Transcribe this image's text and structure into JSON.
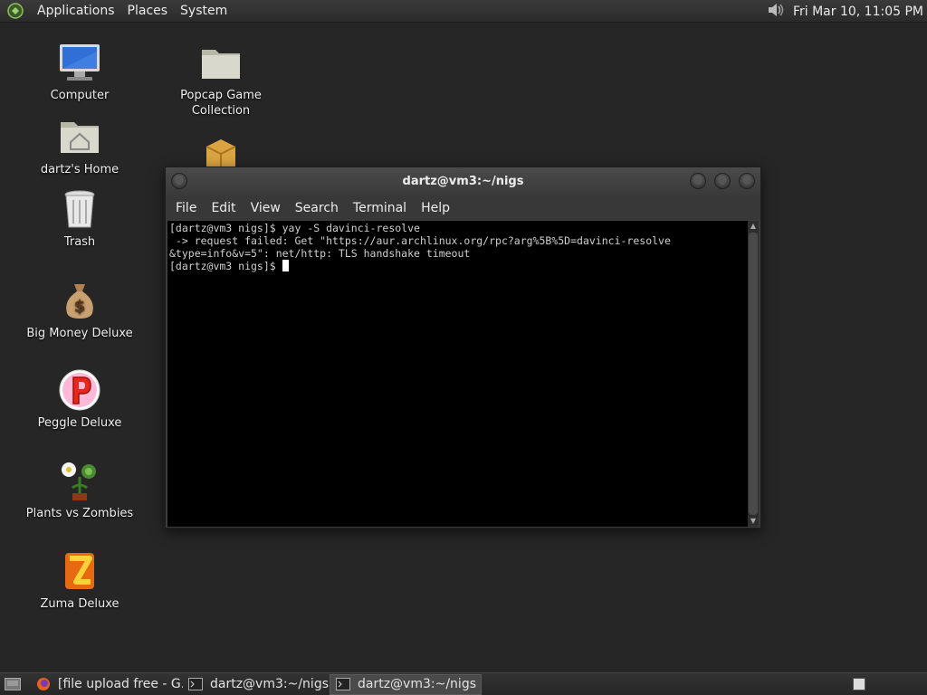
{
  "top_panel": {
    "menus": [
      "Applications",
      "Places",
      "System"
    ],
    "clock": "Fri Mar 10, 11:05 PM"
  },
  "desktop_icons": [
    {
      "label": "Computer",
      "icon": "computer-icon"
    },
    {
      "label": "Popcap Game\nCollection",
      "icon": "folder-icon"
    },
    {
      "label": "dartz's Home",
      "icon": "home-folder-icon"
    },
    {
      "label": "Trash",
      "icon": "trash-icon"
    },
    {
      "label": "Big Money Deluxe",
      "icon": "money-bag-icon"
    },
    {
      "label": "Peggle Deluxe",
      "icon": "peggle-icon"
    },
    {
      "label": "Plants vs Zombies",
      "icon": "plant-icon"
    },
    {
      "label": "Zuma Deluxe",
      "icon": "zuma-icon"
    }
  ],
  "terminal": {
    "title": "dartz@vm3:~/nigs",
    "menu": [
      "File",
      "Edit",
      "View",
      "Search",
      "Terminal",
      "Help"
    ],
    "lines": [
      "[dartz@vm3 nigs]$ yay -S davinci-resolve",
      " -> request failed: Get \"https://aur.archlinux.org/rpc?arg%5B%5D=davinci-resolve",
      "&type=info&v=5\": net/http: TLS handshake timeout",
      "[dartz@vm3 nigs]$"
    ]
  },
  "taskbar": {
    "tasks": [
      {
        "label": "[file upload free - G...",
        "icon": "firefox-icon",
        "active": false
      },
      {
        "label": "dartz@vm3:~/nigs",
        "icon": "terminal-icon",
        "active": false
      },
      {
        "label": "dartz@vm3:~/nigs",
        "icon": "terminal-icon",
        "active": true
      }
    ]
  },
  "colors": {
    "desktop": "#262626",
    "terminal_bg": "#000000",
    "panel": "#333333"
  }
}
